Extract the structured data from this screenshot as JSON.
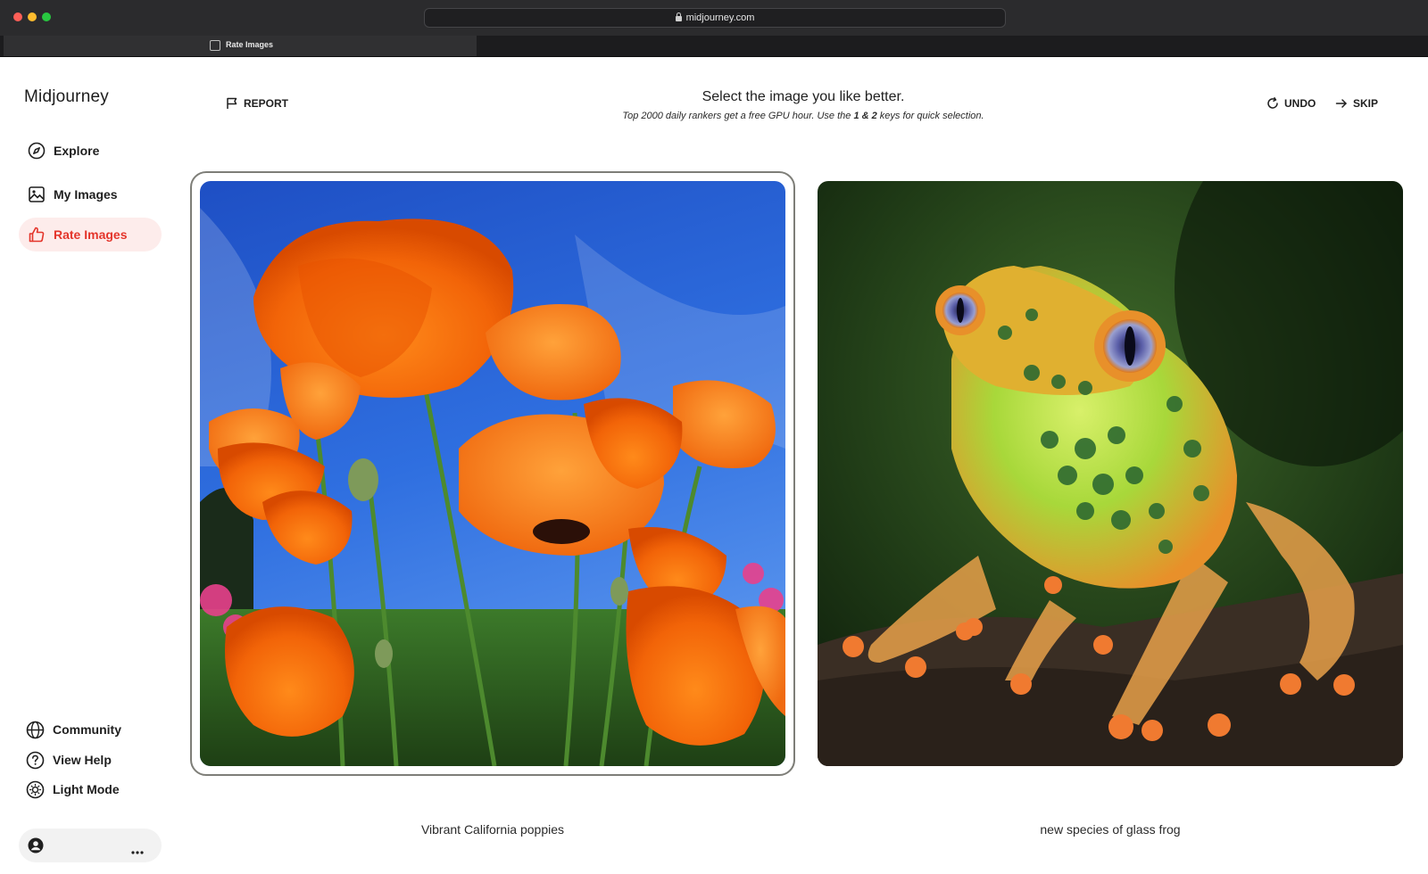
{
  "browser": {
    "url": "midjourney.com",
    "tab_title": "Rate Images"
  },
  "sidebar": {
    "brand": "Midjourney",
    "nav": [
      {
        "label": "Explore",
        "icon": "compass-icon"
      },
      {
        "label": "My Images",
        "icon": "image-icon"
      },
      {
        "label": "Rate Images",
        "icon": "thumbs-up-icon",
        "active": true
      }
    ],
    "bottom": [
      {
        "label": "Community",
        "icon": "globe-icon"
      },
      {
        "label": "View Help",
        "icon": "help-circle-icon"
      },
      {
        "label": "Light Mode",
        "icon": "sun-icon"
      }
    ],
    "user_menu": {
      "avatar_icon": "user-avatar-icon",
      "more_icon": "ellipsis-icon"
    }
  },
  "header": {
    "report_label": "REPORT",
    "title": "Select the image you like better.",
    "subtitle_pre": "Top 2000 daily rankers get a free GPU hour. Use the ",
    "subtitle_keys": "1 & 2",
    "subtitle_post": " keys for quick selection.",
    "undo_label": "UNDO",
    "skip_label": "SKIP"
  },
  "images": [
    {
      "caption": "Vibrant California poppies",
      "selected": true
    },
    {
      "caption": "new species of glass frog",
      "selected": false
    }
  ],
  "colors": {
    "accent": "#e4352b",
    "active_bg": "#fdeceb",
    "frame": "#7e7e78"
  }
}
